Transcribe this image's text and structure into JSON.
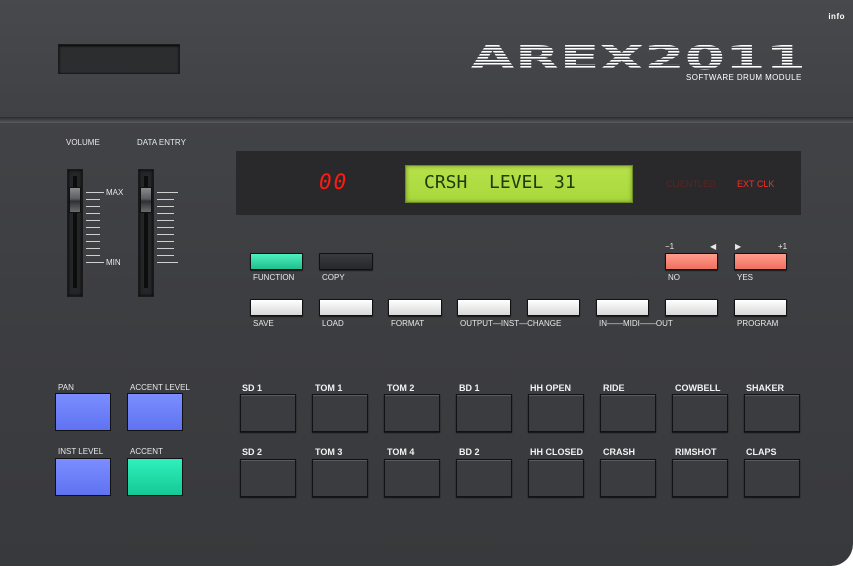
{
  "header": {
    "info_label": "info",
    "logo_text": "AREX2011",
    "logo_subtitle": "SOFTWARE DRUM MODULE"
  },
  "sliders": {
    "volume_label": "VOLUME",
    "data_entry_label": "DATA ENTRY",
    "max_label": "MAX",
    "min_label": "MIN",
    "volume_level": 0.85,
    "data_entry_level": 0.85
  },
  "display": {
    "led_value": "00",
    "lcd_text": "CRSH  LEVEL 31",
    "indicator_dim": "CLIENTLED",
    "indicator_ext": "EXT CLK"
  },
  "controls": {
    "function_label": "FUNCTION",
    "copy_label": "COPY",
    "minus_label": "−1",
    "plus_label": "+1",
    "left_arrow": "◀",
    "right_arrow": "▶",
    "no_label": "NO",
    "yes_label": "YES",
    "save_label": "SAVE",
    "load_label": "LOAD",
    "format_label": "FORMAT",
    "output_inst_change_label": "OUTPUT—INST—CHANGE",
    "midi_label": "IN——MIDI——OUT",
    "program_label": "PROGRAM"
  },
  "left_keys": {
    "pan_label": "PAN",
    "accent_level_label": "ACCENT LEVEL",
    "inst_level_label": "INST LEVEL",
    "accent_label": "ACCENT"
  },
  "pads": {
    "row1": [
      "SD 1",
      "TOM 1",
      "TOM 2",
      "BD 1",
      "HH OPEN",
      "RIDE",
      "COWBELL",
      "SHAKER"
    ],
    "row2": [
      "SD 2",
      "TOM 3",
      "TOM 4",
      "BD 2",
      "HH CLOSED",
      "CRASH",
      "RIMSHOT",
      "CLAPS"
    ]
  },
  "colors": {
    "led_red": "#ff1b12",
    "lcd_green": "#b7e14a",
    "teal": "#1fd39f",
    "blue": "#6c80f8",
    "salmon": "#f48474"
  }
}
